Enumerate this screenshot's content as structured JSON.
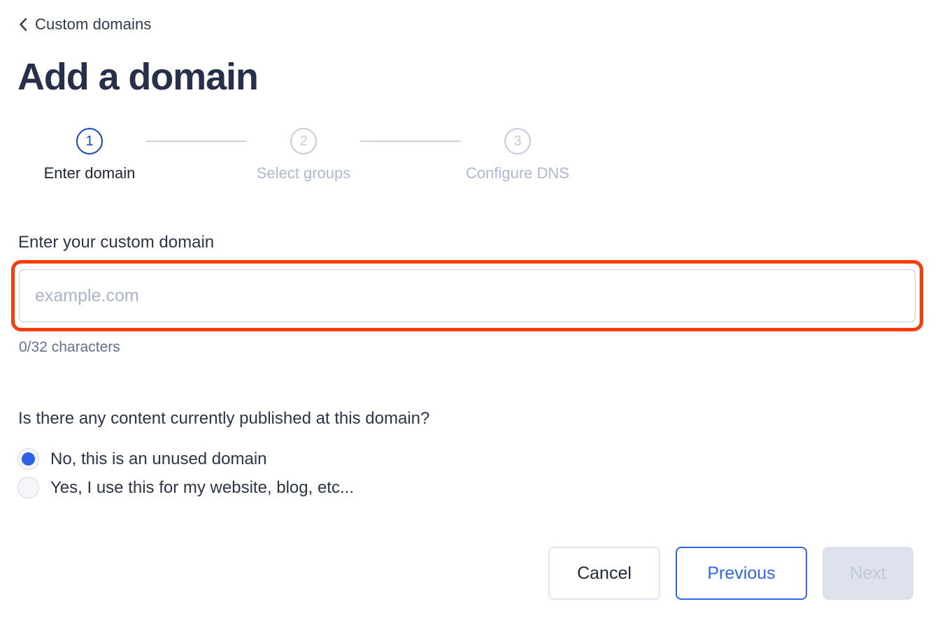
{
  "back_link": {
    "icon": "chevron-left-icon",
    "label": "Custom domains"
  },
  "page_title": "Add a domain",
  "stepper": {
    "current_step": 1,
    "steps": [
      {
        "number": "1",
        "label": "Enter domain",
        "state": "active"
      },
      {
        "number": "2",
        "label": "Select groups",
        "state": "inactive"
      },
      {
        "number": "3",
        "label": "Configure DNS",
        "state": "inactive"
      }
    ]
  },
  "domain_field": {
    "label": "Enter your custom domain",
    "placeholder": "example.com",
    "value": "",
    "char_counter": "0/32 characters",
    "highlighted": true,
    "highlight_color": "#fa3c0a"
  },
  "content_question": {
    "label": "Is there any content currently published at this domain?",
    "options": [
      {
        "label": "No, this is an unused domain",
        "selected": true
      },
      {
        "label": "Yes, I use this for my website, blog, etc...",
        "selected": false
      }
    ]
  },
  "footer": {
    "cancel_label": "Cancel",
    "previous_label": "Previous",
    "next_label": "Next",
    "next_disabled": true
  },
  "colors": {
    "accent_blue": "#2f67e8",
    "active_step_blue": "#1645c4",
    "inactive_gray": "#c3cbdf",
    "text_dark": "#27304a",
    "muted_text": "#627193",
    "highlight_red": "#fa3c0a",
    "disabled_bg": "#dde2ec"
  }
}
